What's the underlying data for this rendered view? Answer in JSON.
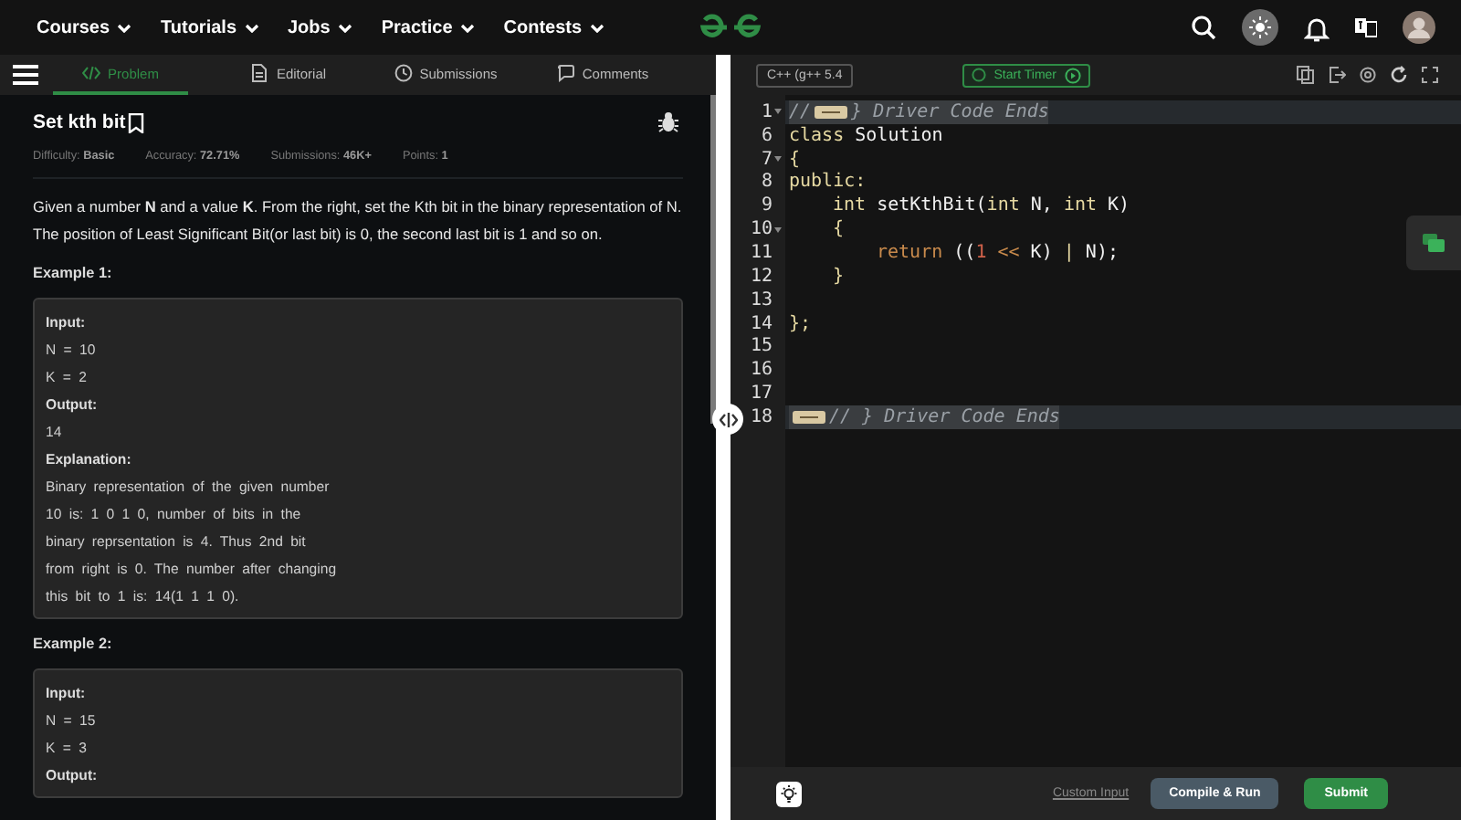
{
  "nav": {
    "items": [
      {
        "label": "Courses"
      },
      {
        "label": "Tutorials"
      },
      {
        "label": "Jobs"
      },
      {
        "label": "Practice"
      },
      {
        "label": "Contests"
      }
    ]
  },
  "tabs": [
    {
      "label": "Problem",
      "selected": true
    },
    {
      "label": "Editorial",
      "selected": false
    },
    {
      "label": "Submissions",
      "selected": false
    },
    {
      "label": "Comments",
      "selected": false
    }
  ],
  "problem": {
    "title": "Set kth bit",
    "meta": [
      {
        "label": "Difficulty:",
        "value": "Basic"
      },
      {
        "label": "Accuracy:",
        "value": "72.71%"
      },
      {
        "label": "Submissions:",
        "value": "46K+"
      },
      {
        "label": "Points:",
        "value": "1"
      }
    ],
    "description": "Given a number **N** and a value **K**. From the right, set the Kth bit in the binary representation of N. The position of Least Significant Bit(or last bit) is 0, the second last bit is 1 and so on.",
    "examples": [
      {
        "heading": "Example 1:",
        "lines": [
          {
            "kind": "label",
            "text": "Input:"
          },
          {
            "kind": "text",
            "text": "N = 10"
          },
          {
            "kind": "text",
            "text": "K = 2"
          },
          {
            "kind": "label",
            "text": "Output:"
          },
          {
            "kind": "text",
            "text": "14"
          },
          {
            "kind": "label",
            "text": "Explanation:"
          },
          {
            "kind": "text",
            "text": "Binary representation of the given number"
          },
          {
            "kind": "text",
            "text": "10 is: 1 0 1 0, number of bits in the"
          },
          {
            "kind": "text",
            "text": "binary reprsentation is 4. Thus 2nd bit"
          },
          {
            "kind": "text",
            "text": "from right is 0. The number after changing"
          },
          {
            "kind": "text",
            "text": "this bit to 1 is: 14(1 1 1 0)."
          }
        ]
      },
      {
        "heading": "Example 2:",
        "lines": [
          {
            "kind": "label",
            "text": "Input:"
          },
          {
            "kind": "text",
            "text": "N = 15"
          },
          {
            "kind": "text",
            "text": "K = 3"
          },
          {
            "kind": "label",
            "text": "Output:"
          }
        ]
      }
    ]
  },
  "editor": {
    "language": "C++ (g++ 5.4",
    "timer": "Start Timer",
    "lines": [
      {
        "number": "1",
        "fold": true,
        "highlighted": true,
        "tokens": [
          {
            "kind": "comment",
            "text": "//"
          },
          {
            "kind": "fold"
          },
          {
            "kind": "comment",
            "text": "} Driver Code Ends"
          }
        ]
      },
      {
        "number": "6",
        "fold": false,
        "highlighted": false,
        "tokens": [
          {
            "kind": "keyword",
            "text": "class"
          },
          {
            "kind": "plain",
            "text": " Solution"
          }
        ]
      },
      {
        "number": "7",
        "fold": true,
        "highlighted": false,
        "tokens": [
          {
            "kind": "open",
            "text": "{"
          }
        ]
      },
      {
        "number": "8",
        "fold": false,
        "highlighted": false,
        "tokens": [
          {
            "kind": "label",
            "text": "public:"
          }
        ]
      },
      {
        "number": "9",
        "fold": false,
        "highlighted": false,
        "tokens": [
          {
            "kind": "keyword",
            "text": "int"
          },
          {
            "kind": "plain",
            "text": " setKthBit("
          },
          {
            "kind": "keyword",
            "text": "int"
          },
          {
            "kind": "plain",
            "text": " N, "
          },
          {
            "kind": "keyword",
            "text": "int"
          },
          {
            "kind": "plain",
            "text": " K)"
          }
        ]
      },
      {
        "number": "10",
        "fold": true,
        "highlighted": false,
        "tokens": [
          {
            "kind": "open",
            "text": "{"
          }
        ]
      },
      {
        "number": "11",
        "fold": false,
        "highlighted": false,
        "tokens": [
          {
            "kind": "control",
            "text": "return"
          },
          {
            "kind": "plain",
            "text": " (("
          },
          {
            "kind": "number",
            "text": "1"
          },
          {
            "kind": "control",
            "text": " <<"
          },
          {
            "kind": "plain",
            "text": " K) "
          },
          {
            "kind": "keyword",
            "text": "|"
          },
          {
            "kind": "plain",
            "text": " N);"
          }
        ]
      },
      {
        "number": "12",
        "fold": false,
        "highlighted": false,
        "tokens": [
          {
            "kind": "close",
            "text": "}"
          }
        ]
      },
      {
        "number": "13",
        "fold": false,
        "highlighted": false
      },
      {
        "number": "14",
        "fold": false,
        "highlighted": false,
        "tokens": [
          {
            "kind": "close",
            "text": "};"
          }
        ]
      },
      {
        "number": "15",
        "fold": false,
        "highlighted": false
      },
      {
        "number": "16",
        "fold": false,
        "highlighted": false
      },
      {
        "number": "17",
        "fold": false,
        "highlighted": false
      },
      {
        "number": "18",
        "fold": false,
        "highlighted": true,
        "tokens": [
          {
            "kind": "fold"
          },
          {
            "kind": "comment",
            "text": "// } Driver Code Ends"
          }
        ]
      }
    ]
  },
  "footer": {
    "custom_input": "Custom Input",
    "compile": "Compile & Run",
    "submit": "Submit"
  }
}
